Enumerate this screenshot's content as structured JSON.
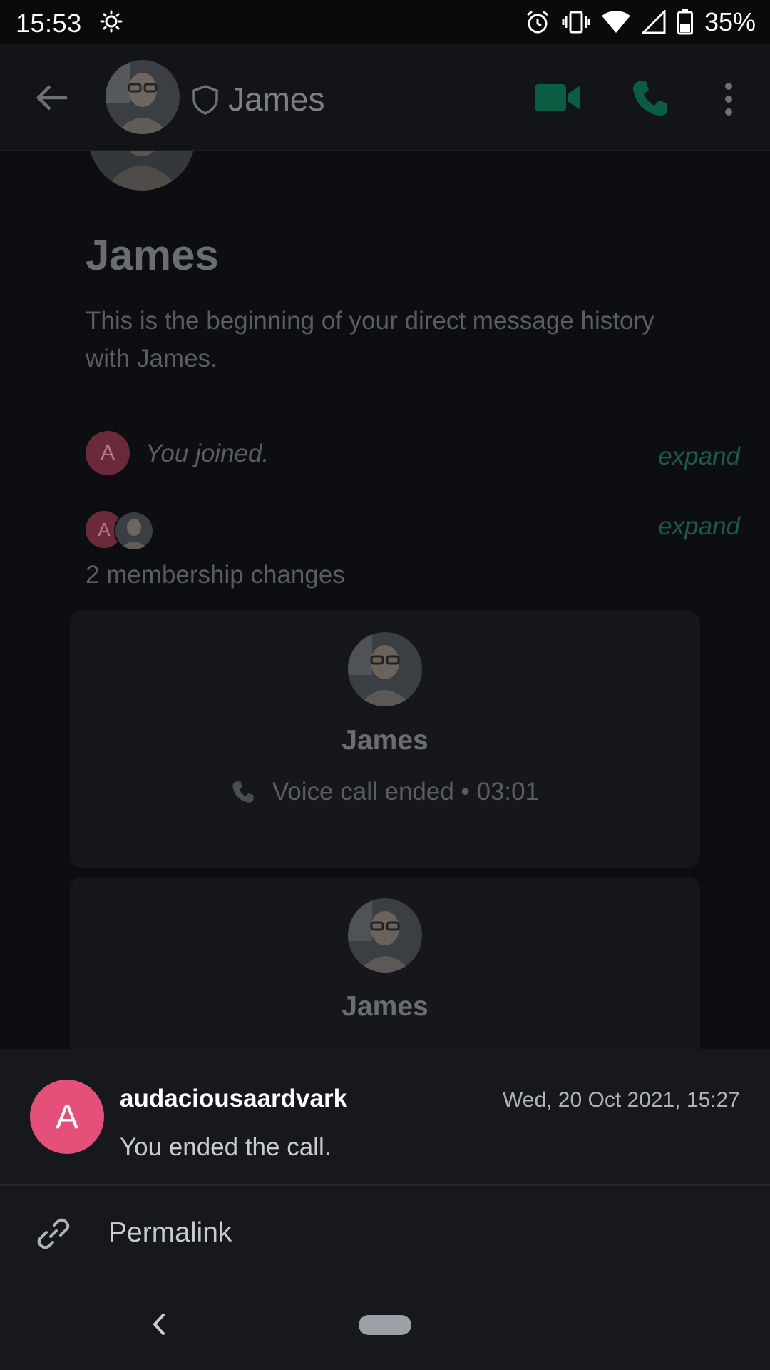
{
  "status_bar": {
    "time": "15:53",
    "battery_percent": "35%",
    "icons": [
      "brightness-icon",
      "alarm-icon",
      "vibrate-icon",
      "wifi-icon",
      "cell-signal-icon",
      "battery-icon"
    ]
  },
  "app_bar": {
    "title": "James",
    "icons": [
      "back-arrow-icon",
      "shield-icon",
      "video-call-icon",
      "phone-call-icon",
      "more-vert-icon"
    ],
    "accent_color": "#0a7a53"
  },
  "timeline": {
    "room_name": "James",
    "intro_text": "This is the beginning of your direct message history with James.",
    "joined_event": {
      "avatar_letter": "A",
      "text": "You joined.",
      "expand_label": "expand"
    },
    "membership_event": {
      "avatar_letter": "A",
      "text": "2 membership changes",
      "expand_label": "expand"
    },
    "call_cards": [
      {
        "name": "James",
        "status": "Voice call ended • 03:01"
      },
      {
        "name": "James"
      }
    ]
  },
  "message_sheet": {
    "avatar_letter": "A",
    "avatar_color": "#e4507a",
    "sender": "audaciousaardvark",
    "timestamp": "Wed, 20 Oct 2021, 15:27",
    "body": "You ended the call.",
    "actions": [
      {
        "label": "Permalink",
        "icon": "link-icon"
      }
    ]
  },
  "nav_bar": {
    "icons": [
      "nav-back-icon",
      "home-pill"
    ]
  }
}
